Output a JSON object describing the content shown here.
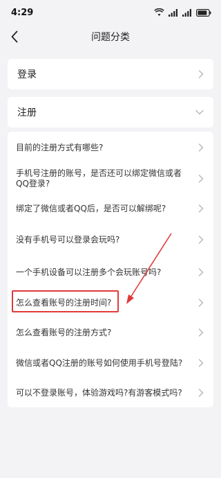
{
  "status": {
    "time": "4:29"
  },
  "nav": {
    "title": "问题分类"
  },
  "categories": [
    {
      "label": "登录",
      "expanded": false
    },
    {
      "label": "注册",
      "expanded": true
    }
  ],
  "questions": [
    "目前的注册方式有哪些?",
    "手机号注册的账号，是否还可以绑定微信或者QQ登录?",
    "绑定了微信或者QQ后，是否可以解绑呢?",
    "没有手机号可以登录会玩吗?",
    "一个手机设备可以注册多个会玩账号吗?",
    "怎么查看账号的注册时间?",
    "怎么查看账号的注册方式?",
    "微信或者QQ注册的账号如何使用手机号登陆?",
    "可以不登录账号，体验游戏吗?有游客模式吗?"
  ],
  "colors": {
    "highlight": "#e03a3a",
    "background": "#f3f3f5",
    "card": "#ffffff"
  }
}
